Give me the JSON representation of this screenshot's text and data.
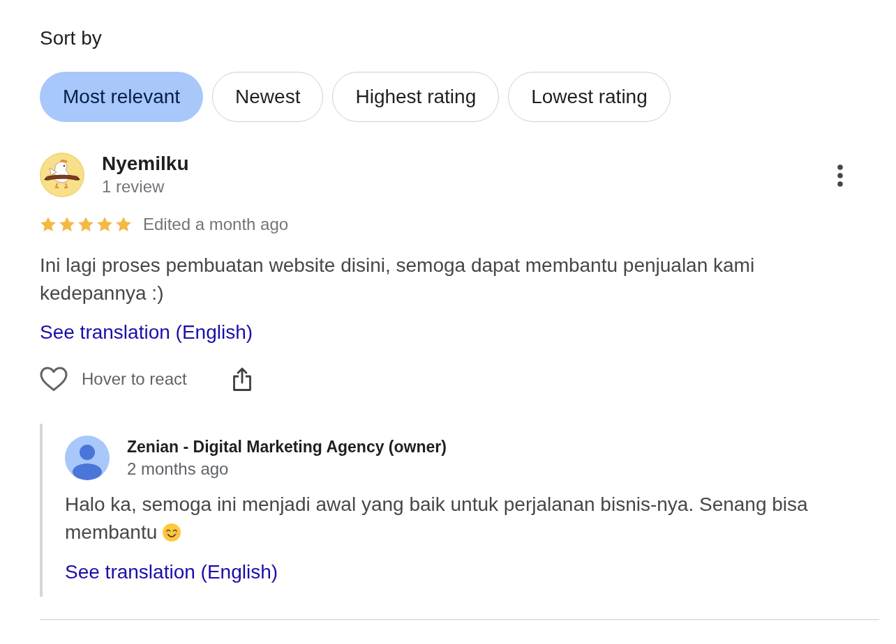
{
  "sort": {
    "label": "Sort by",
    "options": [
      {
        "label": "Most relevant",
        "selected": true
      },
      {
        "label": "Newest",
        "selected": false
      },
      {
        "label": "Highest rating",
        "selected": false
      },
      {
        "label": "Lowest rating",
        "selected": false
      }
    ]
  },
  "review": {
    "author": "Nyemilku",
    "author_meta": "1 review",
    "stars": 5,
    "date": "Edited a month ago",
    "text": "Ini lagi proses pembuatan website disini, semoga dapat membantu penjualan kami kedepannya :)",
    "translate_link": "See translation (English)",
    "react_hint": "Hover to react",
    "owner_reply": {
      "author": "Zenian - Digital Marketing Agency (owner)",
      "date": "2 months ago",
      "text_lines": [
        "Halo ka, semoga ini menjadi awal yang baik untuk perjalanan bisnis-nya. Senang bisa",
        "membantu"
      ],
      "translate_link": "See translation (English)"
    }
  }
}
